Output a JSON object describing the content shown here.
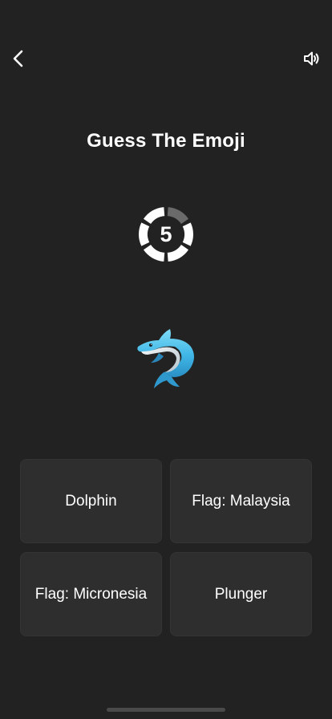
{
  "header": {
    "back_icon": "chevron-left-icon",
    "sound_icon": "speaker-icon"
  },
  "game": {
    "title": "Guess The Emoji",
    "timer_value": "5",
    "timer_segments_total": 6,
    "timer_segments_remaining": 5,
    "emoji_icon": "dolphin-emoji",
    "options": [
      {
        "label": "Dolphin"
      },
      {
        "label": "Flag: Malaysia"
      },
      {
        "label": "Flag: Micronesia"
      },
      {
        "label": "Plunger"
      }
    ]
  },
  "colors": {
    "background": "#222222",
    "option_background": "#2e2e2e",
    "timer_active": "#ffffff",
    "timer_inactive": "#6a6a6a"
  }
}
